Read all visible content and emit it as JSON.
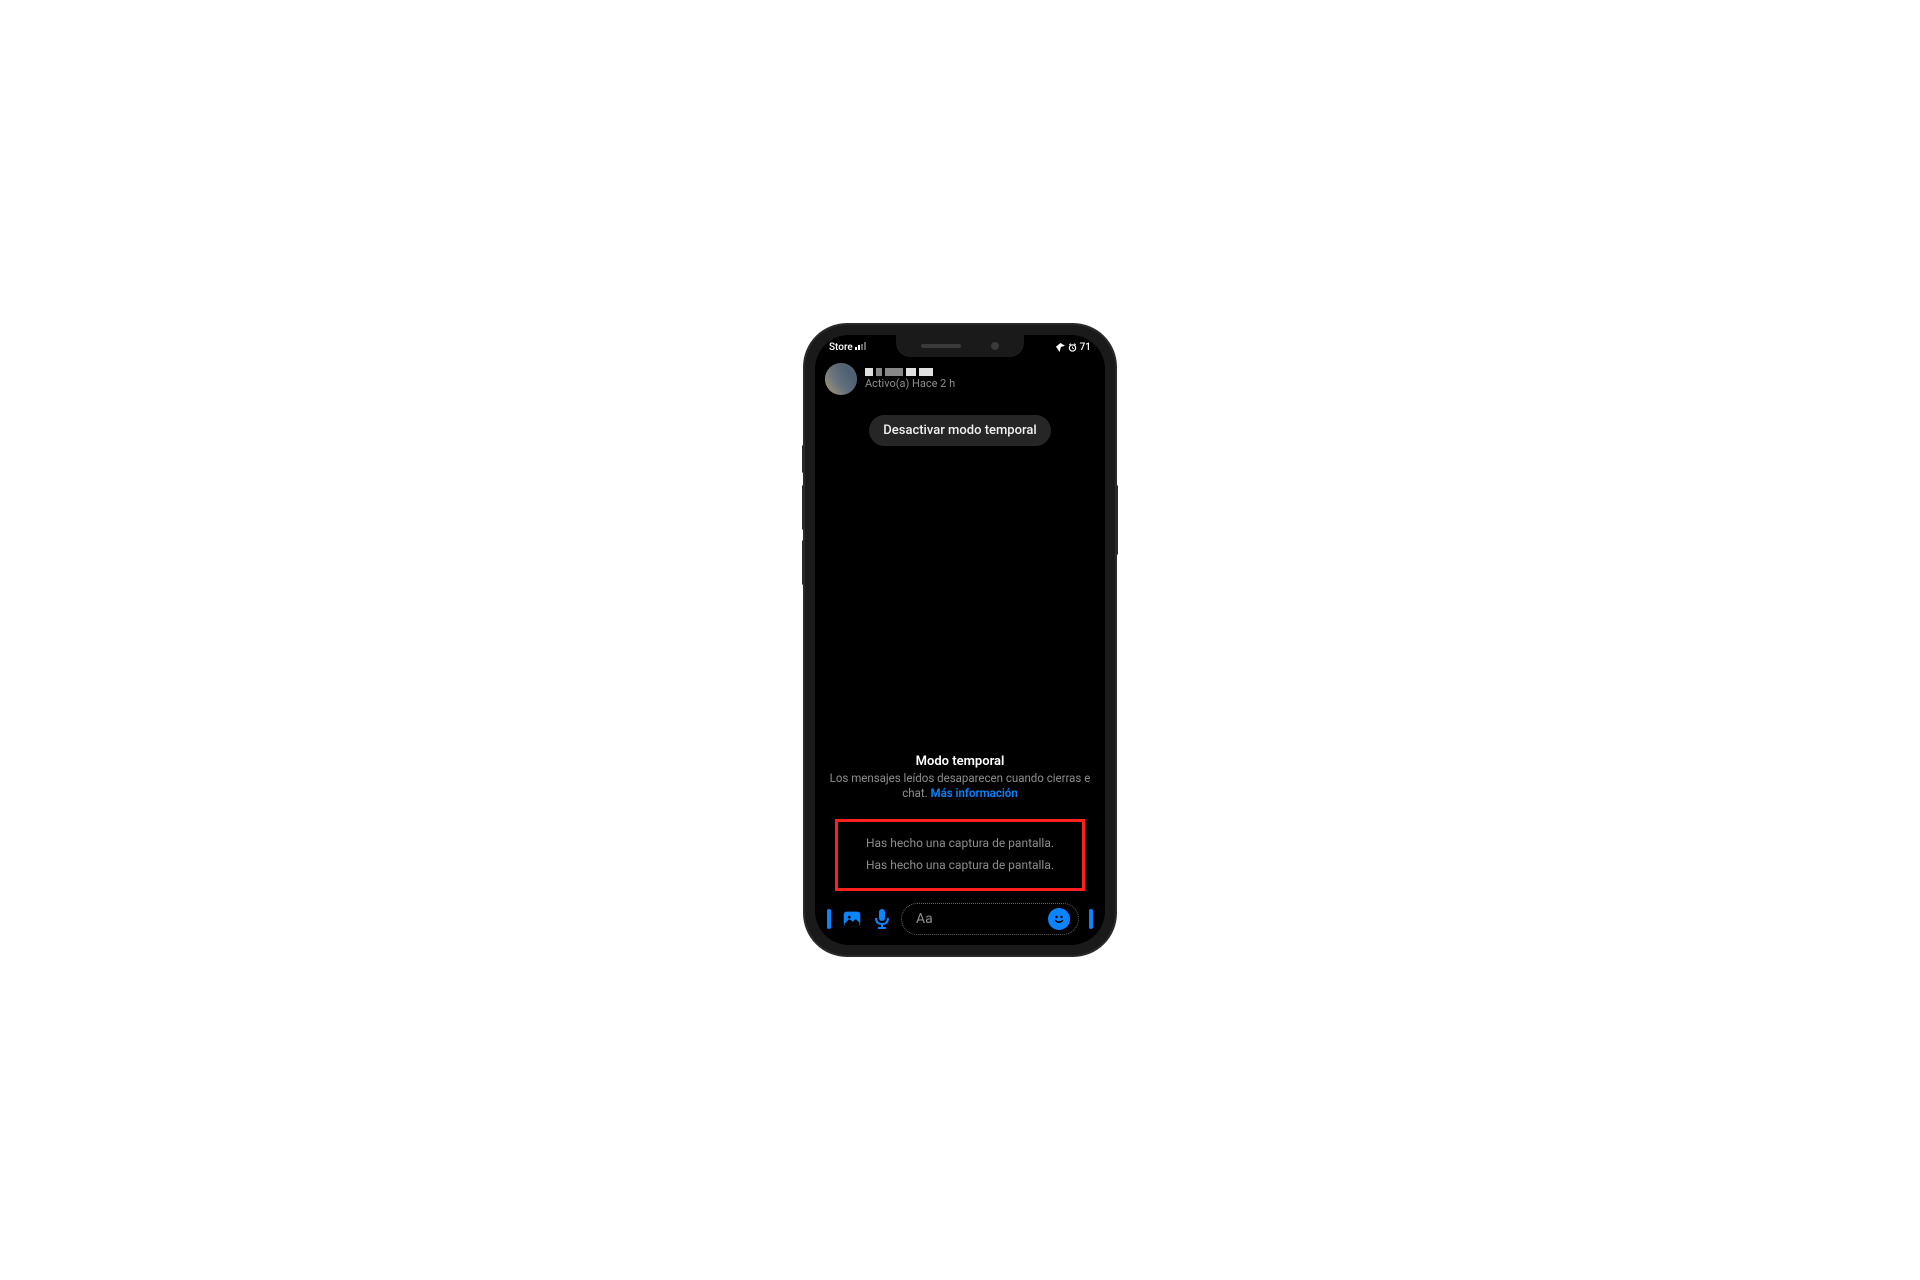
{
  "status_bar": {
    "left": "Store",
    "battery_pct": "71"
  },
  "header": {
    "active_status": "Activo(a) Hace 2 h"
  },
  "vanish_chip_label": "Desactivar modo temporal",
  "vanish_info": {
    "title": "Modo temporal",
    "description_prefix": "Los mensajes leídos desaparecen cuando cierras e chat. ",
    "link_label": "Más información"
  },
  "system_messages": [
    "Has hecho una captura de pantalla.",
    "Has hecho una captura de pantalla."
  ],
  "input": {
    "placeholder": "Aa"
  },
  "colors": {
    "accent": "#0a84ff",
    "highlight_border": "#ff2020"
  }
}
